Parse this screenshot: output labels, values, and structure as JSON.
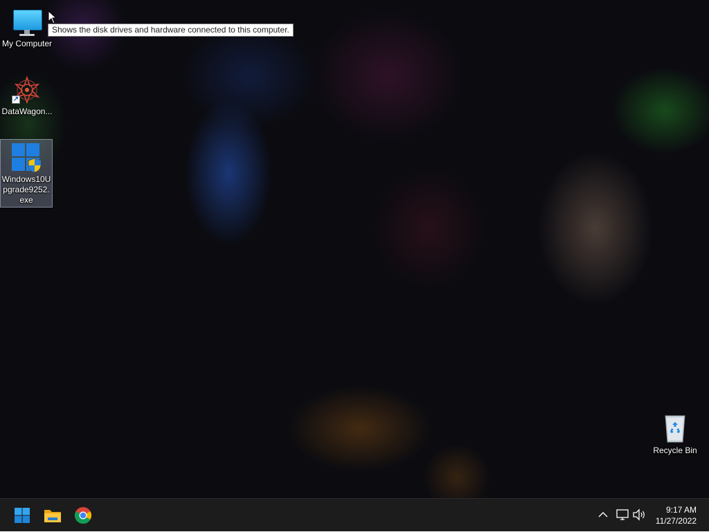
{
  "desktop": {
    "icons": [
      {
        "label": "My Computer",
        "icon": "computer-monitor-icon"
      },
      {
        "label": "DataWagon...",
        "icon": "datawagon-mandala-icon"
      },
      {
        "label": "Windows10Upgrade9252.exe",
        "icon": "windows-upgrade-icon"
      },
      {
        "label": "Recycle Bin",
        "icon": "recycle-bin-icon"
      }
    ],
    "tooltip": "Shows the disk drives and hardware connected to this computer."
  },
  "taskbar": {
    "pinned": [
      {
        "name": "Start",
        "icon": "windows-start-icon"
      },
      {
        "name": "File Explorer",
        "icon": "folder-icon"
      },
      {
        "name": "Google Chrome",
        "icon": "chrome-icon"
      }
    ],
    "tray": {
      "icons": [
        "chevron-up-icon",
        "network-icon",
        "speaker-icon"
      ],
      "time": "9:17 AM",
      "date": "11/27/2022"
    }
  },
  "colors": {
    "taskbar": "#1c1c1c",
    "accent": "#1f7fe0",
    "tooltip_bg": "#ffffff"
  }
}
